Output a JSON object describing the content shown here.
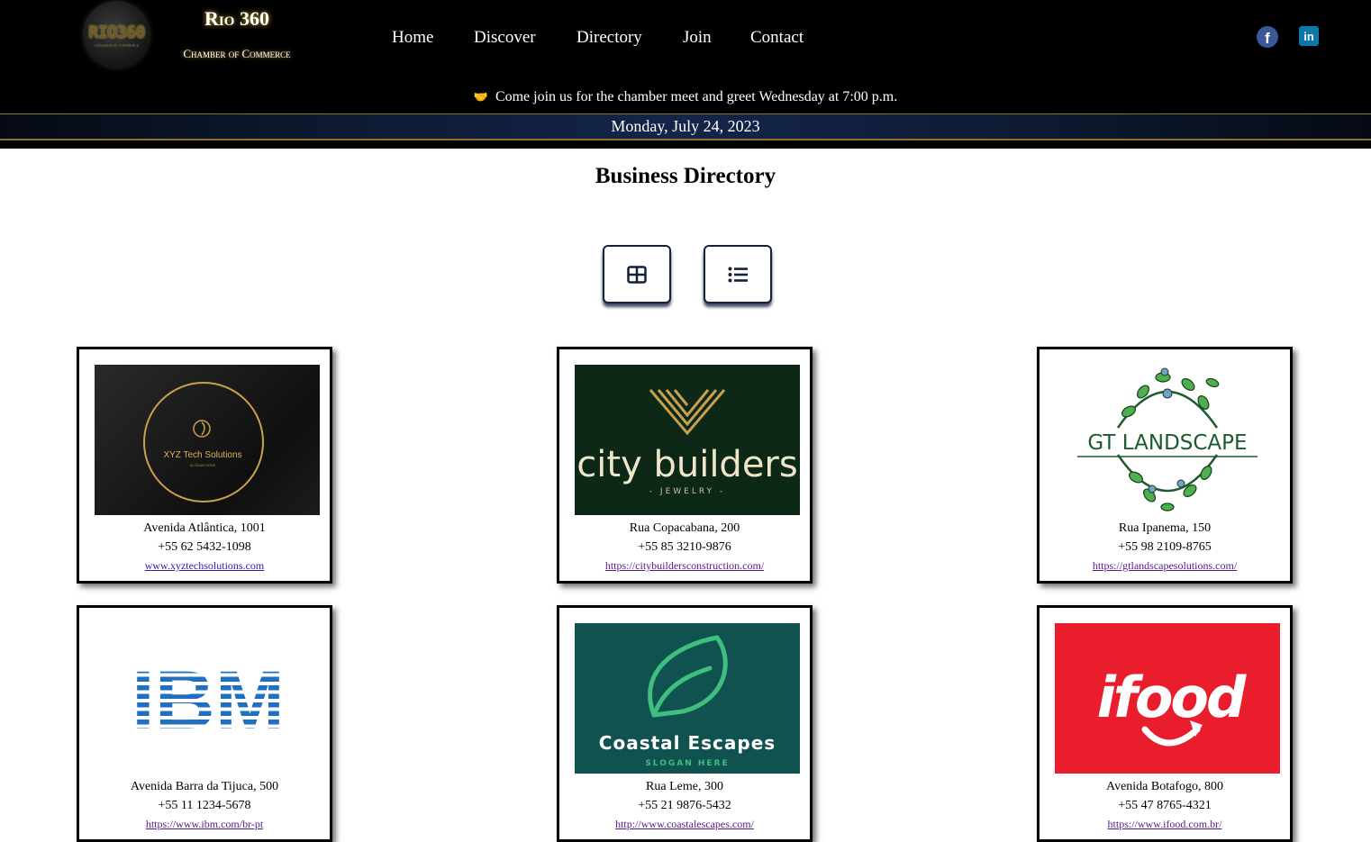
{
  "brand": {
    "logo_text": "RIO360",
    "logo_subtext": "CHAMBER OF COMMERCE",
    "title": "Rio 360",
    "subtitle": "Chamber of Commerce"
  },
  "nav": {
    "items": [
      {
        "label": "Home"
      },
      {
        "label": "Discover"
      },
      {
        "label": "Directory"
      },
      {
        "label": "Join"
      },
      {
        "label": "Contact"
      }
    ]
  },
  "social": {
    "facebook_icon": "facebook-icon",
    "linkedin_icon": "linkedin-icon",
    "facebook_glyph": "f",
    "linkedin_glyph": "in"
  },
  "announcement": {
    "icon": "handshake-icon",
    "text": "Come join us for the chamber meet and greet Wednesday at 7:00 p.m."
  },
  "date": "Monday, July 24, 2023",
  "page_title": "Business Directory",
  "view_toggle": {
    "grid_icon": "grid-view-icon",
    "list_icon": "list-view-icon"
  },
  "colors": {
    "header_bg": "#000000",
    "accent_gold": "#d4af37",
    "button_border": "#14213d"
  },
  "businesses": [
    {
      "logo": {
        "name": "XYZ Tech Solutions",
        "slogan": "SLOGAN HERE"
      },
      "address": "Avenida Atlântica, 1001",
      "phone": "+55 62 5432-1098",
      "website": "www.xyztechsolutions.com"
    },
    {
      "logo": {
        "name": "city builders",
        "slogan": "- JEWELRY -"
      },
      "address": "Rua Copacabana, 200",
      "phone": "+55 85 3210-9876",
      "website": "https://citybuildersconstruction.com/"
    },
    {
      "logo": {
        "name": "GT LANDSCAPE"
      },
      "address": "Rua Ipanema, 150",
      "phone": "+55 98 2109-8765",
      "website": "https://gtlandscapesolutions.com/"
    },
    {
      "logo": {
        "name": "IBM"
      },
      "address": "Avenida Barra da Tijuca, 500",
      "phone": "+55 11 1234-5678",
      "website": "https://www.ibm.com/br-pt"
    },
    {
      "logo": {
        "name": "Coastal Escapes",
        "slogan": "SLOGAN HERE"
      },
      "address": "Rua Leme, 300",
      "phone": "+55 21 9876-5432",
      "website": "http://www.coastalescapes.com/"
    },
    {
      "logo": {
        "name": "ifood"
      },
      "address": "Avenida Botafogo, 800",
      "phone": "+55 47 8765-4321",
      "website": "https://www.ifood.com.br/"
    }
  ]
}
